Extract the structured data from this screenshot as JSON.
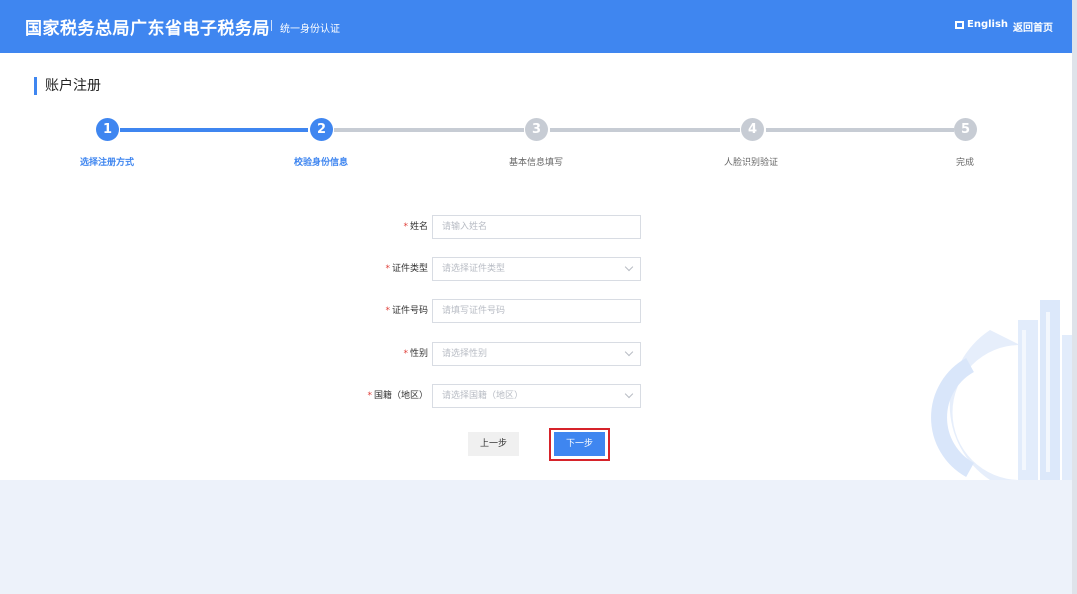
{
  "header": {
    "title": "国家税务总局广东省电子税务局",
    "subtitle": "统一身份认证",
    "lang_label": "English",
    "home_label": "返回首页"
  },
  "page": {
    "title": "账户注册"
  },
  "steps": [
    {
      "number": "1",
      "label": "选择注册方式",
      "state": "done"
    },
    {
      "number": "2",
      "label": "校验身份信息",
      "state": "current"
    },
    {
      "number": "3",
      "label": "基本信息填写",
      "state": "pending"
    },
    {
      "number": "4",
      "label": "人脸识别验证",
      "state": "pending"
    },
    {
      "number": "5",
      "label": "完成",
      "state": "pending"
    }
  ],
  "form": {
    "required_mark": "*",
    "name": {
      "label": "姓名",
      "placeholder": "请输入姓名"
    },
    "id_type": {
      "label": "证件类型",
      "placeholder": "请选择证件类型"
    },
    "id_number": {
      "label": "证件号码",
      "placeholder": "请填写证件号码"
    },
    "gender": {
      "label": "性别",
      "placeholder": "请选择性别"
    },
    "nationality": {
      "label": "国籍（地区）",
      "placeholder": "请选择国籍（地区）"
    }
  },
  "buttons": {
    "prev": "上一步",
    "next": "下一步"
  },
  "colors": {
    "primary": "#3f86f0",
    "pending": "#c7ccd4",
    "required": "#e0403a",
    "highlight": "#d6232a"
  }
}
